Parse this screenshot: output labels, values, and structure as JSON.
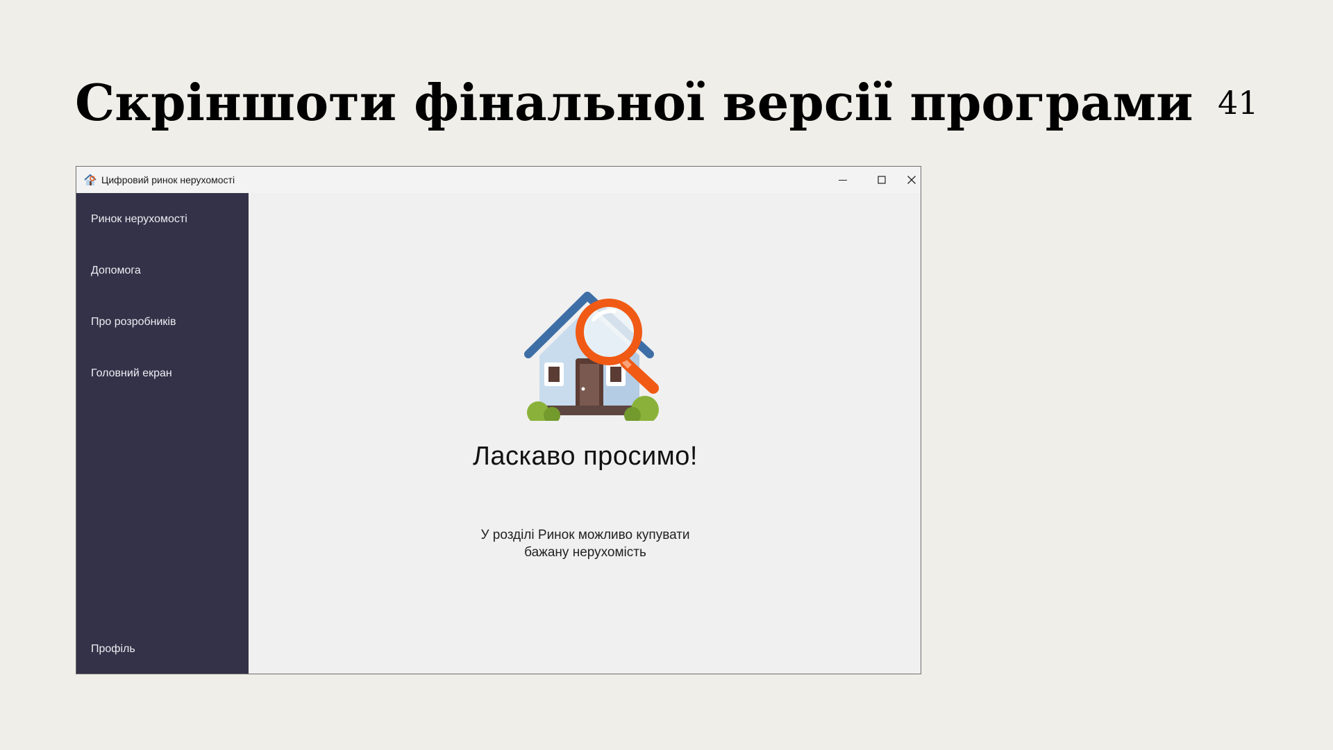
{
  "slide": {
    "title": "Скріншоти фінальної версії програми",
    "page_number": "41"
  },
  "window": {
    "title": "Цифровий ринок нерухомості",
    "app_icon": "house-app-icon",
    "controls": {
      "minimize_icon": "minimize-icon",
      "maximize_icon": "maximize-icon",
      "close_icon": "close-icon"
    }
  },
  "sidebar": {
    "items": [
      {
        "label": "Ринок нерухомості"
      },
      {
        "label": "Допомога"
      },
      {
        "label": "Про розробників"
      },
      {
        "label": "Головний екран"
      }
    ],
    "bottom_item": {
      "label": "Профіль"
    }
  },
  "main": {
    "illustration": "house-search-icon",
    "title": "Ласкаво просимо!",
    "description_line1": "У розділі Ринок можливо купувати",
    "description_line2": "бажану нерухомість"
  },
  "colors": {
    "slide_background": "#efeee8",
    "sidebar_background": "#333248",
    "content_background": "#f0f0f0",
    "accent_orange": "#f05a14"
  }
}
